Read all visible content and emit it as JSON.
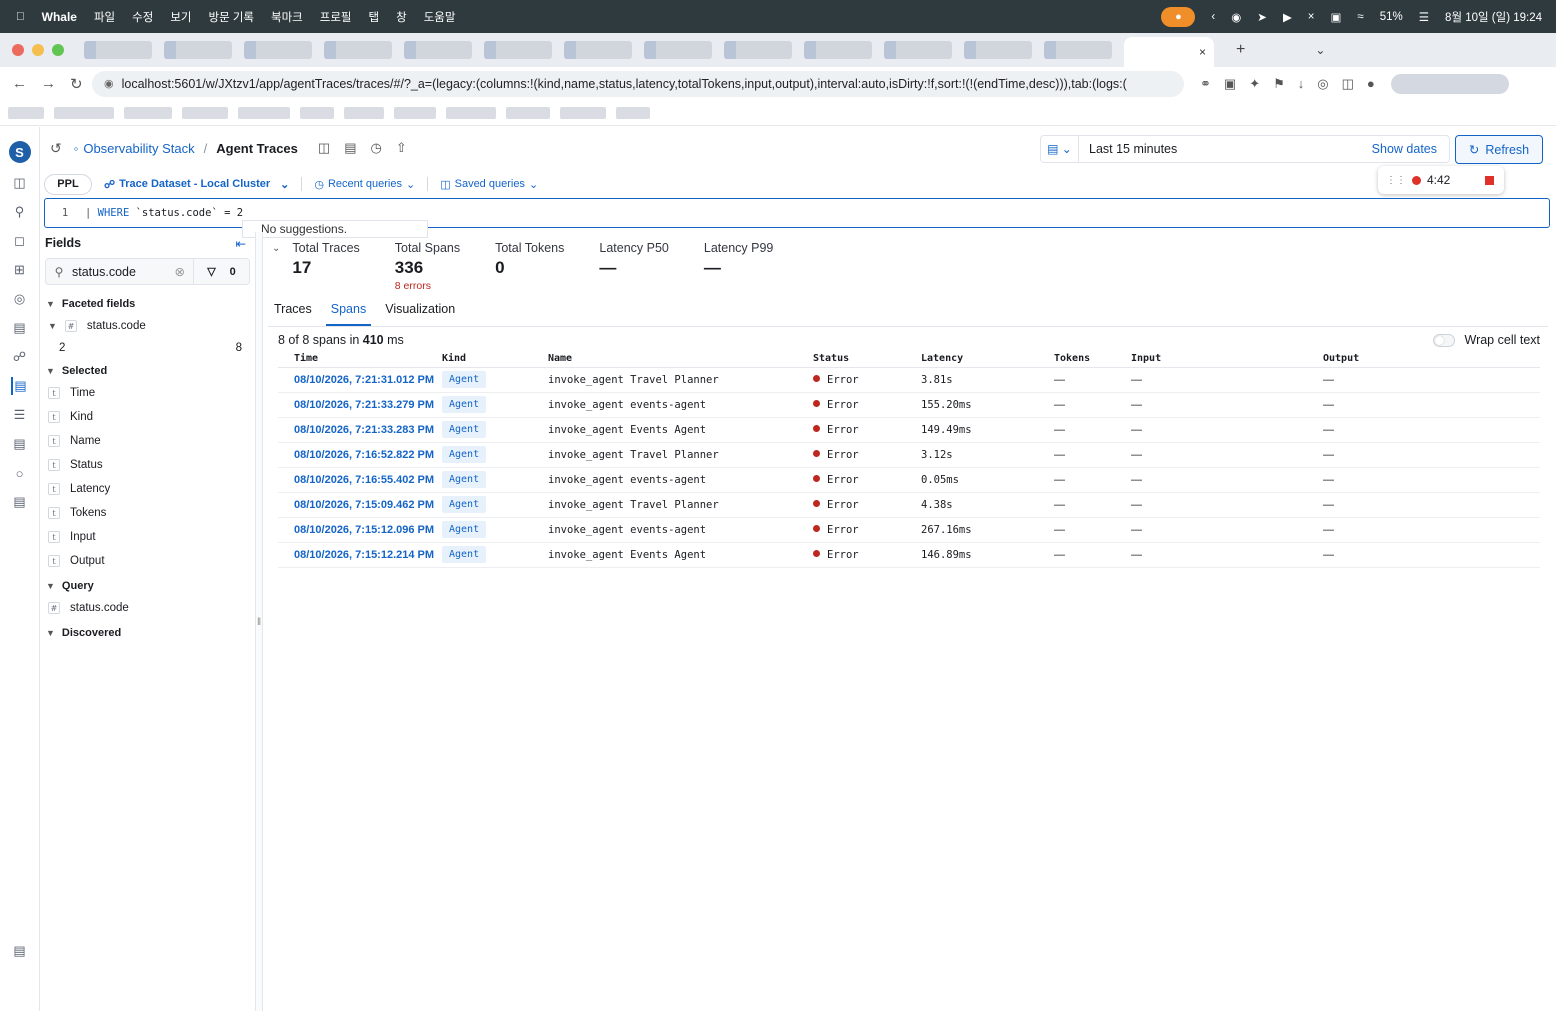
{
  "menubar": {
    "app": "Whale",
    "items": [
      "파일",
      "수정",
      "보기",
      "방문 기록",
      "북마크",
      "프로필",
      "탭",
      "창",
      "도움말"
    ],
    "battery": "51%",
    "datetime": "8월 10일 (일) 19:24"
  },
  "browser": {
    "url": "localhost:5601/w/JXtzv1/app/agentTraces/traces/#/?_a=(legacy:(columns:!(kind,name,status,latency,totalTokens,input,output),interval:auto,isDirty:!f,sort:!(!(endTime,desc))),tab:(logs:("
  },
  "header": {
    "breadcrumb_root": "Observability Stack",
    "breadcrumb_current": "Agent Traces",
    "time_range": "Last 15 minutes",
    "show_dates": "Show dates",
    "refresh": "Refresh"
  },
  "query": {
    "language": "PPL",
    "dataset": "Trace Dataset - Local Cluster",
    "recent": "Recent queries",
    "saved": "Saved queries",
    "line_number": "1",
    "code_prefix": "| ",
    "code_keyword": "WHERE",
    "code_rest": " `status.code` = 2",
    "suggestion": "No suggestions."
  },
  "recorder": {
    "time": "4:42"
  },
  "sidebar": {
    "title": "Fields",
    "search_value": "status.code",
    "filter_count": "0",
    "faceted_title": "Faceted fields",
    "faceted_field": "status.code",
    "facet_value": "2",
    "facet_count": "8",
    "selected_title": "Selected",
    "selected_fields": [
      "Time",
      "Kind",
      "Name",
      "Status",
      "Latency",
      "Tokens",
      "Input",
      "Output"
    ],
    "query_title": "Query",
    "query_field": "status.code",
    "discovered_title": "Discovered"
  },
  "stats": [
    {
      "label": "Total Traces",
      "value": "17",
      "note": ""
    },
    {
      "label": "Total Spans",
      "value": "336",
      "note": "8 errors"
    },
    {
      "label": "Total Tokens",
      "value": "0",
      "note": ""
    },
    {
      "label": "Latency P50",
      "value": "—",
      "note": ""
    },
    {
      "label": "Latency P99",
      "value": "—",
      "note": ""
    }
  ],
  "tabs": [
    "Traces",
    "Spans",
    "Visualization"
  ],
  "summary": {
    "prefix": "8 of 8 spans in ",
    "ms": "410",
    "suffix": " ms"
  },
  "wrap_label": "Wrap cell text",
  "table": {
    "columns": [
      "Time",
      "Kind",
      "Name",
      "Status",
      "Latency",
      "Tokens",
      "Input",
      "Output"
    ],
    "rows": [
      {
        "time": "08/10/2026, 7:21:31.012 PM",
        "kind": "Agent",
        "name": "invoke_agent Travel Planner",
        "status": "Error",
        "latency": "3.81s",
        "tokens": "—",
        "input": "—",
        "output": "—"
      },
      {
        "time": "08/10/2026, 7:21:33.279 PM",
        "kind": "Agent",
        "name": "invoke_agent events-agent",
        "status": "Error",
        "latency": "155.20ms",
        "tokens": "—",
        "input": "—",
        "output": "—"
      },
      {
        "time": "08/10/2026, 7:21:33.283 PM",
        "kind": "Agent",
        "name": "invoke_agent Events Agent",
        "status": "Error",
        "latency": "149.49ms",
        "tokens": "—",
        "input": "—",
        "output": "—"
      },
      {
        "time": "08/10/2026, 7:16:52.822 PM",
        "kind": "Agent",
        "name": "invoke_agent Travel Planner",
        "status": "Error",
        "latency": "3.12s",
        "tokens": "—",
        "input": "—",
        "output": "—"
      },
      {
        "time": "08/10/2026, 7:16:55.402 PM",
        "kind": "Agent",
        "name": "invoke_agent events-agent",
        "status": "Error",
        "latency": "0.05ms",
        "tokens": "—",
        "input": "—",
        "output": "—"
      },
      {
        "time": "08/10/2026, 7:15:09.462 PM",
        "kind": "Agent",
        "name": "invoke_agent Travel Planner",
        "status": "Error",
        "latency": "4.38s",
        "tokens": "—",
        "input": "—",
        "output": "—"
      },
      {
        "time": "08/10/2026, 7:15:12.096 PM",
        "kind": "Agent",
        "name": "invoke_agent events-agent",
        "status": "Error",
        "latency": "267.16ms",
        "tokens": "—",
        "input": "—",
        "output": "—"
      },
      {
        "time": "08/10/2026, 7:15:12.214 PM",
        "kind": "Agent",
        "name": "invoke_agent Events Agent",
        "status": "Error",
        "latency": "146.89ms",
        "tokens": "—",
        "input": "—",
        "output": "—"
      }
    ]
  }
}
